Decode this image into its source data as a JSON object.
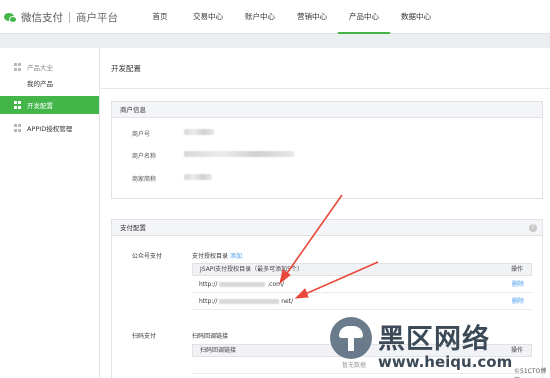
{
  "header": {
    "brand": "微信支付",
    "subtitle": "商户平台",
    "nav": [
      {
        "label": "首页"
      },
      {
        "label": "交易中心"
      },
      {
        "label": "账户中心"
      },
      {
        "label": "营销中心"
      },
      {
        "label": "产品中心",
        "active": true
      },
      {
        "label": "数据中心"
      }
    ]
  },
  "sidebar": {
    "group_label": "产品大全",
    "my_products": "我的产品",
    "active_item": "开发配置",
    "appid_item": "APPID授权管理"
  },
  "main": {
    "page_title": "开发配置",
    "merchant_panel": {
      "title": "商户信息",
      "fields": [
        {
          "label": "商户号"
        },
        {
          "label": "商户名称"
        },
        {
          "label": "商家简称"
        }
      ]
    },
    "payment_panel": {
      "title": "支付配置",
      "help_icon": "?",
      "mp_label": "公众号支付",
      "dir_label": "支付授权目录",
      "add_label": "添加",
      "table_header": "JSAPI支付授权目录（最多可添加5个）",
      "op_header": "操作",
      "rows": [
        {
          "url": "http://",
          "suffix": ".com/",
          "op": "删除"
        },
        {
          "url": "http://",
          "suffix": "net/",
          "op": "删除"
        }
      ],
      "scan_label": "扫码支付",
      "scan_sub_label": "扫码回调链接",
      "scan_table_header": "扫码回调链接",
      "scan_op_header": "操作",
      "scan_bottom_cell": "暂无数据"
    }
  },
  "watermark": {
    "title": "黑区网络",
    "url": "www.heiqu.com",
    "small": "©51CTO博客"
  },
  "colors": {
    "accent": "#44b549",
    "link": "#459ae9",
    "arrow": "#e8493a"
  }
}
